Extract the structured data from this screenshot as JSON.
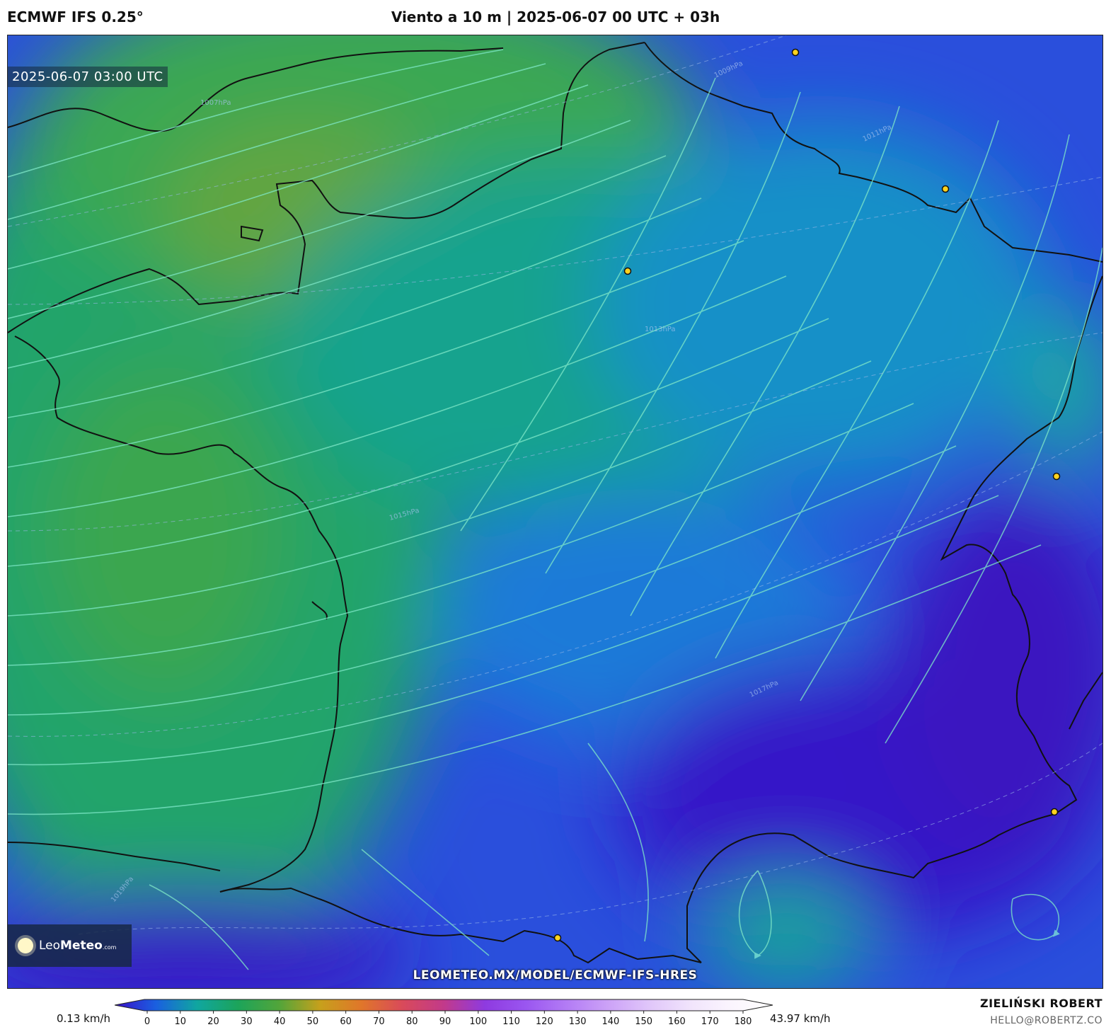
{
  "header": {
    "model": "ECMWF IFS 0.25°",
    "title": "Viento a 10 m | 2025-06-07 00 UTC + 03h"
  },
  "map": {
    "valid_time": "2025-06-07 03:00 UTC",
    "source_url": "LEOMETEO.MX/MODEL/ECMWF-IFS-HRES",
    "logo": {
      "name": "LeoMeteo",
      "suffix": ".com"
    },
    "isobar_labels": [
      "1007hPa",
      "1009hPa",
      "1011hPa",
      "1013hPa",
      "1015hPa",
      "1017hPa",
      "1019hPa"
    ],
    "colors": {
      "low": "#3a1bd0",
      "mid": "#1f8cd8",
      "high": "#21a46a",
      "max": "#5ea33e",
      "coast": "#111111",
      "city": "#ffd21e"
    }
  },
  "colorbar": {
    "min_label": "0.13 km/h",
    "max_label": "43.97 km/h",
    "ticks": [
      "0",
      "10",
      "20",
      "30",
      "40",
      "50",
      "60",
      "70",
      "80",
      "90",
      "100",
      "110",
      "120",
      "130",
      "140",
      "150",
      "160",
      "170",
      "180"
    ],
    "stops": [
      "#3a10c8",
      "#1a5fe0",
      "#10a6a0",
      "#1ca45a",
      "#52a53a",
      "#c7a01c",
      "#e0762a",
      "#d94a5a",
      "#c23a8a",
      "#8e3ae0",
      "#9a56f0",
      "#b37cf5",
      "#cca2f7",
      "#e0c6fa",
      "#f1e4fc",
      "#fbf5fe",
      "#ffffff"
    ]
  },
  "credits": {
    "author": "ZIELIŃSKI ROBERT",
    "email": "HELLO@ROBERTZ.CO"
  }
}
